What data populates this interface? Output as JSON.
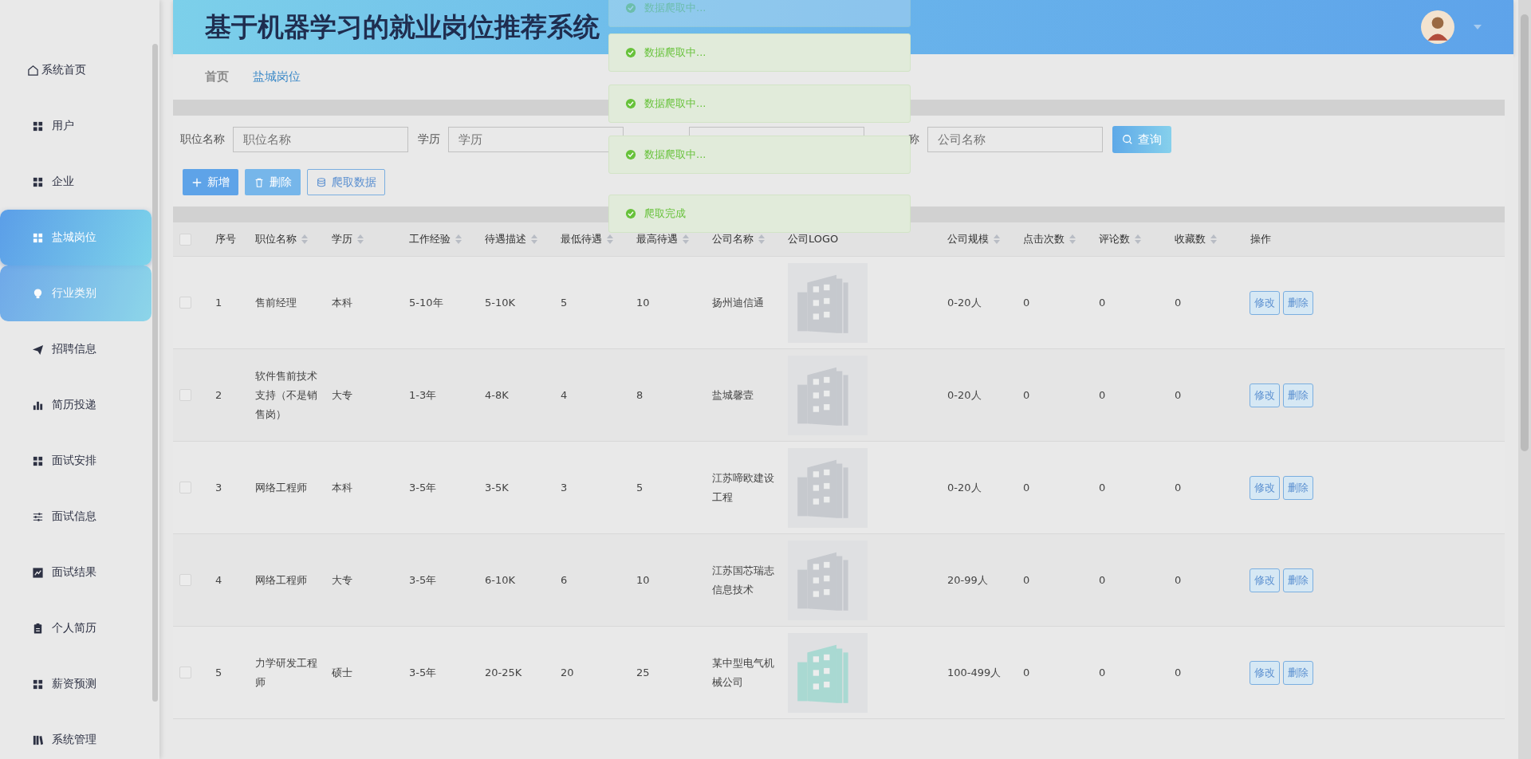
{
  "sidebar": {
    "items": [
      {
        "label": "系统首页",
        "kind": "home",
        "selected": false,
        "hovered": false
      },
      {
        "label": "用户",
        "kind": "grid",
        "selected": false,
        "hovered": false
      },
      {
        "label": "企业",
        "kind": "grid",
        "selected": false,
        "hovered": false
      },
      {
        "label": "盐城岗位",
        "kind": "grid",
        "selected": true,
        "hovered": false
      },
      {
        "label": "行业类别",
        "kind": "bulb",
        "selected": false,
        "hovered": true
      },
      {
        "label": "招聘信息",
        "kind": "plane",
        "selected": false,
        "hovered": false
      },
      {
        "label": "简历投递",
        "kind": "bars",
        "selected": false,
        "hovered": false
      },
      {
        "label": "面试安排",
        "kind": "grid",
        "selected": false,
        "hovered": false
      },
      {
        "label": "面试信息",
        "kind": "sliders",
        "selected": false,
        "hovered": false
      },
      {
        "label": "面试结果",
        "kind": "chart",
        "selected": false,
        "hovered": false
      },
      {
        "label": "个人简历",
        "kind": "clipboard",
        "selected": false,
        "hovered": false
      },
      {
        "label": "薪资预测",
        "kind": "grid",
        "selected": false,
        "hovered": false
      },
      {
        "label": "系统管理",
        "kind": "book",
        "selected": false,
        "hovered": false
      }
    ]
  },
  "header": {
    "title": "基于机器学习的就业岗位推荐系统"
  },
  "breadcrumb": [
    {
      "label": "首页",
      "selected": false
    },
    {
      "label": "盐城岗位",
      "selected": true
    }
  ],
  "search": {
    "fields": [
      {
        "kind": "input",
        "label": "职位名称",
        "placeholder": "职位名称"
      },
      {
        "kind": "input",
        "label": "学历",
        "placeholder": "学历"
      },
      {
        "kind": "input"
      },
      {
        "kind": "input",
        "label": "称",
        "placeholder": "公司名称"
      }
    ],
    "button": "查询"
  },
  "actions": [
    {
      "kind": "add",
      "label": "新增"
    },
    {
      "kind": "delete",
      "label": "删除"
    },
    {
      "kind": "crawl",
      "label": "爬取数据"
    }
  ],
  "table": {
    "header_checked": false,
    "columns": [
      {
        "label": "序号",
        "sortable": false
      },
      {
        "label": "职位名称",
        "sortable": true
      },
      {
        "label": "学历",
        "sortable": true
      },
      {
        "label": "工作经验",
        "sortable": true
      },
      {
        "label": "待遇描述",
        "sortable": true
      },
      {
        "label": "最低待遇",
        "sortable": true
      },
      {
        "label": "最高待遇",
        "sortable": true
      },
      {
        "label": "公司名称",
        "sortable": true
      },
      {
        "label": "公司LOGO",
        "sortable": false
      },
      {
        "label": "公司规模",
        "sortable": true
      },
      {
        "label": "点击次数",
        "sortable": true
      },
      {
        "label": "评论数",
        "sortable": true
      },
      {
        "label": "收藏数",
        "sortable": true
      },
      {
        "label": "操作",
        "sortable": false
      }
    ],
    "rows": [
      {
        "checked": false,
        "cells": [
          "1",
          "售前经理",
          "本科",
          "5-10年",
          "5-10K",
          "5",
          "10",
          "扬州迪信通"
        ],
        "logo": {
          "kind": "picture",
          "color": "#c6c9ce"
        },
        "cells2": [
          "0-20人",
          "0",
          "0",
          "0"
        ],
        "buttons": [
          "修改",
          "删除"
        ]
      },
      {
        "checked": false,
        "cells": [
          "2",
          "软件售前技术支持（不是销售岗）",
          "大专",
          "1-3年",
          "4-8K",
          "4",
          "8",
          "盐城馨壹"
        ],
        "logo": {
          "kind": "picture",
          "color": "#c6c9ce"
        },
        "cells2": [
          "0-20人",
          "0",
          "0",
          "0"
        ],
        "buttons": [
          "修改",
          "删除"
        ]
      },
      {
        "checked": false,
        "cells": [
          "3",
          "网络工程师",
          "本科",
          "3-5年",
          "3-5K",
          "3",
          "5",
          "江苏啼欧建设工程"
        ],
        "logo": {
          "kind": "picture",
          "color": "#c6c9ce"
        },
        "cells2": [
          "0-20人",
          "0",
          "0",
          "0"
        ],
        "buttons": [
          "修改",
          "删除"
        ]
      },
      {
        "checked": false,
        "cells": [
          "4",
          "网络工程师",
          "大专",
          "3-5年",
          "6-10K",
          "6",
          "10",
          "江苏国芯瑞志信息技术"
        ],
        "logo": {
          "kind": "picture",
          "color": "#c6c9ce"
        },
        "cells2": [
          "20-99人",
          "0",
          "0",
          "0"
        ],
        "buttons": [
          "修改",
          "删除"
        ]
      },
      {
        "checked": false,
        "cells": [
          "5",
          "力学研发工程师",
          "硕士",
          "3-5年",
          "20-25K",
          "20",
          "25",
          "某中型电气机械公司"
        ],
        "logo": {
          "kind": "picture",
          "color": "#a9d9d2"
        },
        "cells2": [
          "100-499人",
          "0",
          "0",
          "0"
        ],
        "buttons": [
          "修改",
          "删除"
        ]
      }
    ]
  },
  "toasts": [
    {
      "text": "数据爬取中...",
      "faded": true
    },
    {
      "text": "数据爬取中...",
      "faded": false
    },
    {
      "text": "数据爬取中...",
      "faded": false
    },
    {
      "text": "数据爬取中...",
      "faded": false
    },
    {
      "text": "爬取完成",
      "faded": false
    }
  ]
}
